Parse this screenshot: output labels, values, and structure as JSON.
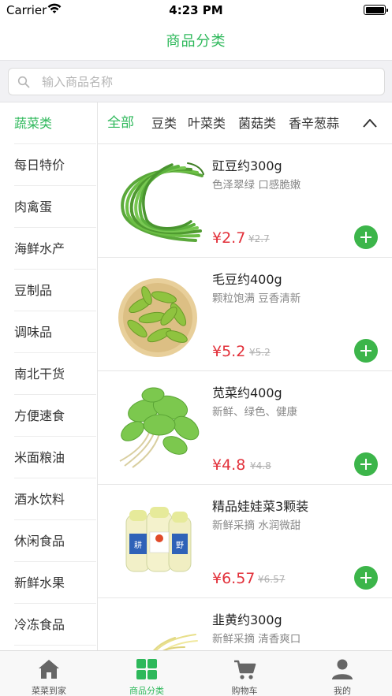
{
  "status_bar": {
    "carrier": "Carrier",
    "time": "4:23 PM"
  },
  "header": {
    "title": "商品分类"
  },
  "search": {
    "placeholder": "输入商品名称"
  },
  "sidebar": {
    "items": [
      {
        "label": "蔬菜类",
        "active": true
      },
      {
        "label": "每日特价"
      },
      {
        "label": "肉禽蛋"
      },
      {
        "label": "海鲜水产"
      },
      {
        "label": "豆制品"
      },
      {
        "label": "调味品"
      },
      {
        "label": "南北干货"
      },
      {
        "label": "方便速食"
      },
      {
        "label": "米面粮油"
      },
      {
        "label": "酒水饮料"
      },
      {
        "label": "休闲食品"
      },
      {
        "label": "新鲜水果"
      },
      {
        "label": "冷冻食品"
      }
    ]
  },
  "subtabs": [
    {
      "label": "全部",
      "active": true
    },
    {
      "label": "豆类"
    },
    {
      "label": "叶菜类"
    },
    {
      "label": "菌菇类"
    },
    {
      "label": "香辛葱蒜"
    }
  ],
  "products": [
    {
      "name": "豇豆约300g",
      "desc": " 色泽翠绿 口感脆嫩",
      "price": "¥2.7",
      "old_price": "¥2.7",
      "image_icon": "long-beans-image"
    },
    {
      "name": "毛豆约400g",
      "desc": "颗粒饱满 豆香清新",
      "price": "¥5.2",
      "old_price": "¥5.2",
      "image_icon": "edamame-image"
    },
    {
      "name": "苋菜约400g",
      "desc": "新鲜、绿色、健康",
      "price": "¥4.8",
      "old_price": "¥4.8",
      "image_icon": "amaranth-image"
    },
    {
      "name": "精品娃娃菜3颗装",
      "desc": "新鲜采摘 水润微甜",
      "price": "¥6.57",
      "old_price": "¥6.57",
      "image_icon": "baby-cabbage-image"
    },
    {
      "name": "韭黄约300g",
      "desc": "新鲜采摘 清香爽口",
      "price": "",
      "old_price": "",
      "image_icon": "yellow-chives-image"
    }
  ],
  "tabbar": {
    "items": [
      {
        "label": "菜菜到家",
        "icon": "home-icon"
      },
      {
        "label": "商品分类",
        "icon": "category-grid-icon",
        "active": true
      },
      {
        "label": "购物车",
        "icon": "cart-icon"
      },
      {
        "label": "我的",
        "icon": "user-icon"
      }
    ]
  },
  "colors": {
    "accent": "#2db85a",
    "price": "#e2303a",
    "add_button": "#3cb54a",
    "inactive_icon": "#666666"
  }
}
